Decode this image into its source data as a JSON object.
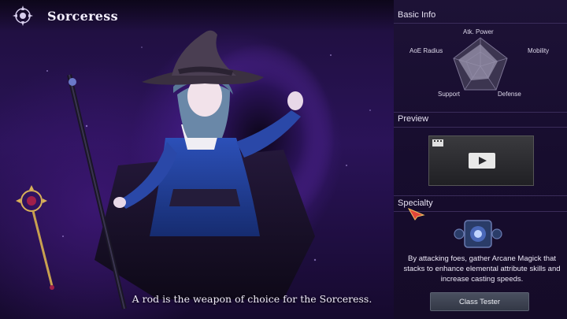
{
  "header": {
    "class_name": "Sorceress",
    "emblem_icon": "sorceress-class-emblem"
  },
  "caption": "A rod is the weapon of choice for the Sorceress.",
  "panel": {
    "basic_info": {
      "title": "Basic Info",
      "stats": [
        {
          "label": "Atk. Power"
        },
        {
          "label": "Mobility"
        },
        {
          "label": "Defense"
        },
        {
          "label": "Support"
        },
        {
          "label": "AoE Radius"
        }
      ]
    },
    "preview": {
      "title": "Preview",
      "play_icon": "play-icon"
    },
    "specialty": {
      "title": "Specialty",
      "description": "By attacking foes, gather Arcane Magick that stacks to enhance elemental attribute skills and increase casting speeds."
    },
    "class_tester_label": "Class Tester"
  },
  "colors": {
    "background": "#1e0f3c",
    "accent": "#6a32b8",
    "panel": "#1d1236",
    "button": "#4a5060"
  }
}
